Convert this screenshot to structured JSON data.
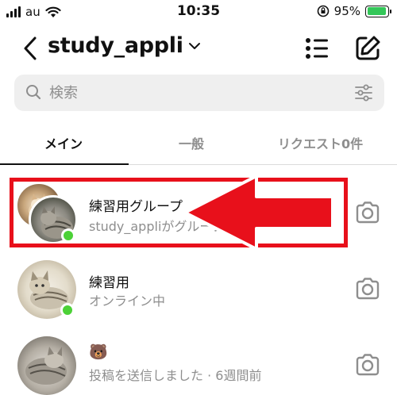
{
  "status_bar": {
    "carrier": "au",
    "time": "10:35",
    "battery_percent": "95%",
    "battery_level": 0.95
  },
  "header": {
    "title": "study_appli",
    "icons": [
      "chevron-left-icon",
      "chevron-down-icon",
      "list-icon",
      "compose-icon"
    ]
  },
  "search": {
    "placeholder": "検索"
  },
  "tabs": [
    {
      "label": "メイン",
      "active": true
    },
    {
      "label": "一般",
      "active": false
    },
    {
      "label": "リクエスト0件",
      "active": false
    }
  ],
  "conversations": [
    {
      "name": "練習用グループ",
      "subtitle": "study_appliがグループ",
      "online": true,
      "group": true
    },
    {
      "name": "練習用",
      "subtitle": "オンライン中",
      "online": true,
      "group": false
    },
    {
      "name": "🐻",
      "subtitle": "投稿を送信しました · 6週間前",
      "online": false,
      "group": false
    }
  ],
  "colors": {
    "annotation_red": "#e8101b",
    "online_green": "#4cd137",
    "battery_green": "#34c759",
    "muted_text": "#8e8e8e"
  }
}
